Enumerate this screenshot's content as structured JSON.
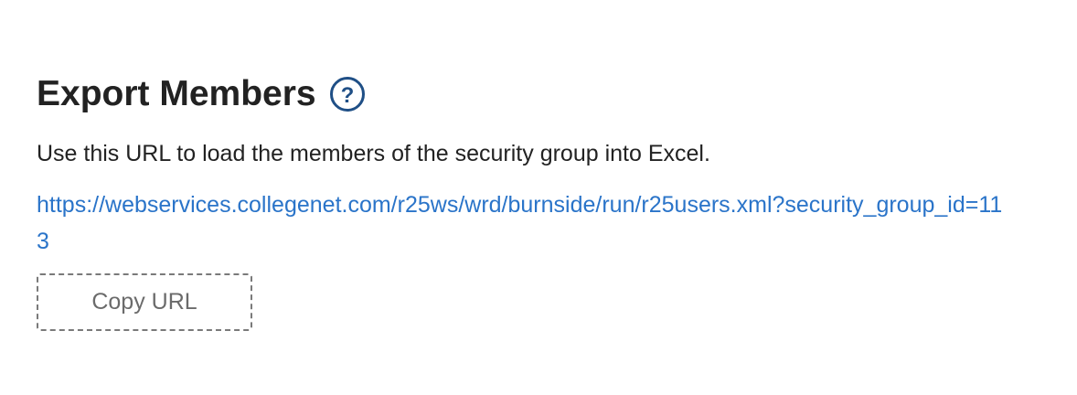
{
  "section": {
    "title": "Export Members",
    "help_icon": "question-circle-icon",
    "description": "Use this URL to load the members of the security group into Excel.",
    "export_url": "https://webservices.collegenet.com/r25ws/wrd/burnside/run/r25users.xml?security_group_id=113",
    "copy_button_label": "Copy URL"
  },
  "colors": {
    "link": "#2a74c9",
    "help_icon": "#1f4f86",
    "text": "#222222",
    "button_text": "#6b6b6b"
  }
}
